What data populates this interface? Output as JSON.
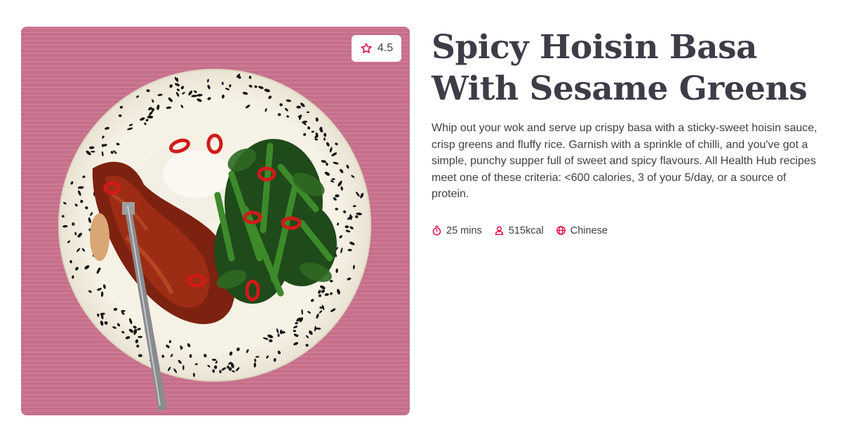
{
  "recipe": {
    "title": "Spicy Hoisin Basa With Sesame Greens",
    "rating": "4.5",
    "description": "Whip out your wok and serve up crispy basa with a sticky-sweet hoisin sauce, crisp greens and fluffy rice. Garnish with a sprinkle of chilli, and you've got a simple, punchy supper full of sweet and spicy flavours. All Health Hub recipes meet one of these criteria: <600 calories, 3 of your 5/day, or a source of protein.",
    "meta": {
      "time": "25 mins",
      "calories": "515kcal",
      "cuisine": "Chinese"
    }
  },
  "icons": {
    "rating": "star-icon",
    "time": "timer-icon",
    "calories": "person-icon",
    "cuisine": "globe-icon"
  },
  "colors": {
    "accent": "#e4003b",
    "title": "#3c3d47",
    "text": "#3f4048",
    "photo_background": "#c9758f"
  }
}
